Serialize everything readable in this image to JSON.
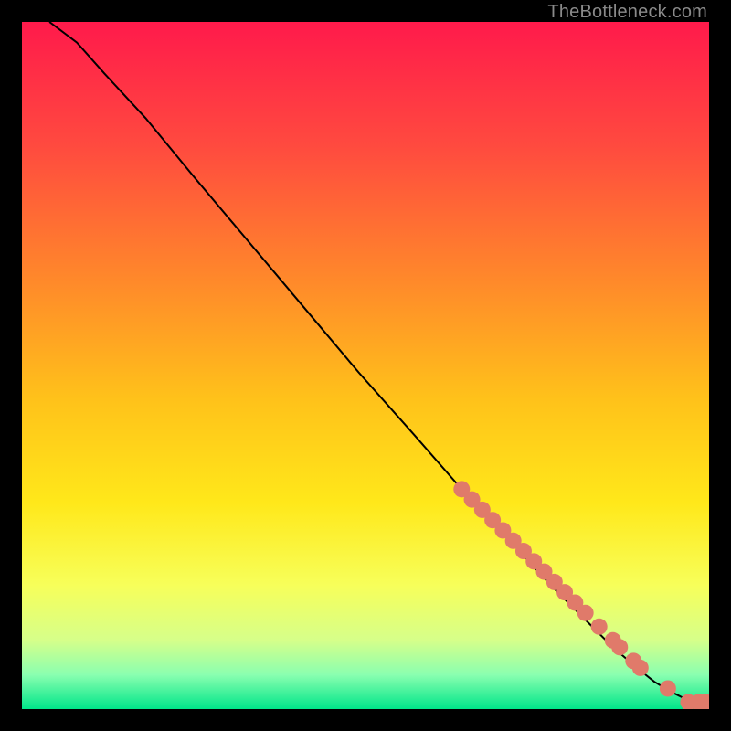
{
  "watermark": "TheBottleneck.com",
  "chart_data": {
    "type": "line",
    "title": "",
    "xlabel": "",
    "ylabel": "",
    "xlim": [
      0,
      100
    ],
    "ylim": [
      0,
      100
    ],
    "grid": false,
    "gradient_stops": [
      {
        "offset": 0,
        "color": "#ff1a4b"
      },
      {
        "offset": 18,
        "color": "#ff4a3f"
      },
      {
        "offset": 38,
        "color": "#ff8a2a"
      },
      {
        "offset": 55,
        "color": "#ffc21a"
      },
      {
        "offset": 70,
        "color": "#ffe81a"
      },
      {
        "offset": 82,
        "color": "#f7ff5a"
      },
      {
        "offset": 90,
        "color": "#d6ff8a"
      },
      {
        "offset": 95,
        "color": "#8affb0"
      },
      {
        "offset": 100,
        "color": "#00e589"
      }
    ],
    "series": [
      {
        "name": "curve",
        "color": "#000000",
        "x": [
          4,
          8,
          12,
          18,
          25,
          33,
          41,
          49,
          57,
          64,
          71,
          77,
          82,
          86,
          89.5,
          92,
          94.5,
          96.5,
          98,
          99.5
        ],
        "y": [
          100,
          97,
          92.5,
          86,
          77.5,
          68,
          58.5,
          49,
          40,
          32,
          24.5,
          18,
          13,
          9,
          6,
          4,
          2.5,
          1.5,
          1,
          1
        ]
      }
    ],
    "markers": {
      "name": "dots",
      "color": "#e07a6a",
      "radius_px": 9,
      "x": [
        64,
        65.5,
        67,
        68.5,
        70,
        71.5,
        73,
        74.5,
        76,
        77.5,
        79,
        80.5,
        82,
        84,
        86,
        87,
        89,
        90,
        94,
        97,
        98.5,
        99.5
      ],
      "y": [
        32,
        30.5,
        29,
        27.5,
        26,
        24.5,
        23,
        21.5,
        20,
        18.5,
        17,
        15.5,
        14,
        12,
        10,
        9,
        7,
        6,
        3,
        1,
        1,
        1
      ]
    }
  }
}
